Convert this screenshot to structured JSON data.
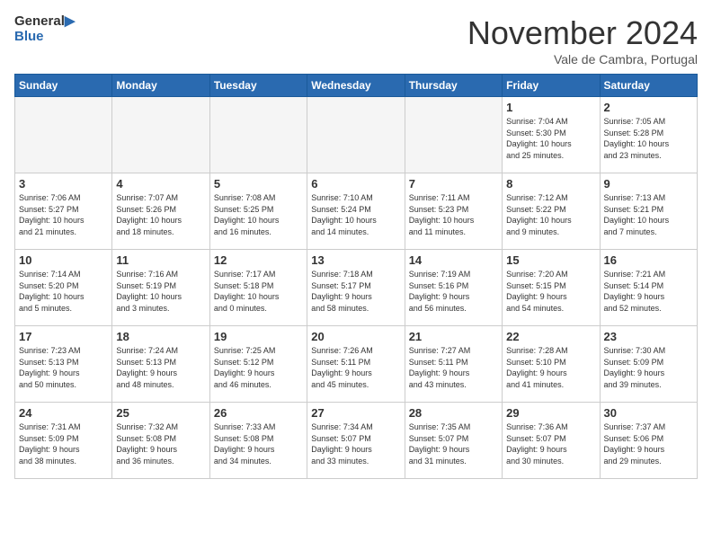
{
  "header": {
    "logo_line1": "General",
    "logo_line2": "Blue",
    "month_title": "November 2024",
    "location": "Vale de Cambra, Portugal"
  },
  "weekdays": [
    "Sunday",
    "Monday",
    "Tuesday",
    "Wednesday",
    "Thursday",
    "Friday",
    "Saturday"
  ],
  "weeks": [
    [
      {
        "day": "",
        "info": ""
      },
      {
        "day": "",
        "info": ""
      },
      {
        "day": "",
        "info": ""
      },
      {
        "day": "",
        "info": ""
      },
      {
        "day": "",
        "info": ""
      },
      {
        "day": "1",
        "info": "Sunrise: 7:04 AM\nSunset: 5:30 PM\nDaylight: 10 hours\nand 25 minutes."
      },
      {
        "day": "2",
        "info": "Sunrise: 7:05 AM\nSunset: 5:28 PM\nDaylight: 10 hours\nand 23 minutes."
      }
    ],
    [
      {
        "day": "3",
        "info": "Sunrise: 7:06 AM\nSunset: 5:27 PM\nDaylight: 10 hours\nand 21 minutes."
      },
      {
        "day": "4",
        "info": "Sunrise: 7:07 AM\nSunset: 5:26 PM\nDaylight: 10 hours\nand 18 minutes."
      },
      {
        "day": "5",
        "info": "Sunrise: 7:08 AM\nSunset: 5:25 PM\nDaylight: 10 hours\nand 16 minutes."
      },
      {
        "day": "6",
        "info": "Sunrise: 7:10 AM\nSunset: 5:24 PM\nDaylight: 10 hours\nand 14 minutes."
      },
      {
        "day": "7",
        "info": "Sunrise: 7:11 AM\nSunset: 5:23 PM\nDaylight: 10 hours\nand 11 minutes."
      },
      {
        "day": "8",
        "info": "Sunrise: 7:12 AM\nSunset: 5:22 PM\nDaylight: 10 hours\nand 9 minutes."
      },
      {
        "day": "9",
        "info": "Sunrise: 7:13 AM\nSunset: 5:21 PM\nDaylight: 10 hours\nand 7 minutes."
      }
    ],
    [
      {
        "day": "10",
        "info": "Sunrise: 7:14 AM\nSunset: 5:20 PM\nDaylight: 10 hours\nand 5 minutes."
      },
      {
        "day": "11",
        "info": "Sunrise: 7:16 AM\nSunset: 5:19 PM\nDaylight: 10 hours\nand 3 minutes."
      },
      {
        "day": "12",
        "info": "Sunrise: 7:17 AM\nSunset: 5:18 PM\nDaylight: 10 hours\nand 0 minutes."
      },
      {
        "day": "13",
        "info": "Sunrise: 7:18 AM\nSunset: 5:17 PM\nDaylight: 9 hours\nand 58 minutes."
      },
      {
        "day": "14",
        "info": "Sunrise: 7:19 AM\nSunset: 5:16 PM\nDaylight: 9 hours\nand 56 minutes."
      },
      {
        "day": "15",
        "info": "Sunrise: 7:20 AM\nSunset: 5:15 PM\nDaylight: 9 hours\nand 54 minutes."
      },
      {
        "day": "16",
        "info": "Sunrise: 7:21 AM\nSunset: 5:14 PM\nDaylight: 9 hours\nand 52 minutes."
      }
    ],
    [
      {
        "day": "17",
        "info": "Sunrise: 7:23 AM\nSunset: 5:13 PM\nDaylight: 9 hours\nand 50 minutes."
      },
      {
        "day": "18",
        "info": "Sunrise: 7:24 AM\nSunset: 5:13 PM\nDaylight: 9 hours\nand 48 minutes."
      },
      {
        "day": "19",
        "info": "Sunrise: 7:25 AM\nSunset: 5:12 PM\nDaylight: 9 hours\nand 46 minutes."
      },
      {
        "day": "20",
        "info": "Sunrise: 7:26 AM\nSunset: 5:11 PM\nDaylight: 9 hours\nand 45 minutes."
      },
      {
        "day": "21",
        "info": "Sunrise: 7:27 AM\nSunset: 5:11 PM\nDaylight: 9 hours\nand 43 minutes."
      },
      {
        "day": "22",
        "info": "Sunrise: 7:28 AM\nSunset: 5:10 PM\nDaylight: 9 hours\nand 41 minutes."
      },
      {
        "day": "23",
        "info": "Sunrise: 7:30 AM\nSunset: 5:09 PM\nDaylight: 9 hours\nand 39 minutes."
      }
    ],
    [
      {
        "day": "24",
        "info": "Sunrise: 7:31 AM\nSunset: 5:09 PM\nDaylight: 9 hours\nand 38 minutes."
      },
      {
        "day": "25",
        "info": "Sunrise: 7:32 AM\nSunset: 5:08 PM\nDaylight: 9 hours\nand 36 minutes."
      },
      {
        "day": "26",
        "info": "Sunrise: 7:33 AM\nSunset: 5:08 PM\nDaylight: 9 hours\nand 34 minutes."
      },
      {
        "day": "27",
        "info": "Sunrise: 7:34 AM\nSunset: 5:07 PM\nDaylight: 9 hours\nand 33 minutes."
      },
      {
        "day": "28",
        "info": "Sunrise: 7:35 AM\nSunset: 5:07 PM\nDaylight: 9 hours\nand 31 minutes."
      },
      {
        "day": "29",
        "info": "Sunrise: 7:36 AM\nSunset: 5:07 PM\nDaylight: 9 hours\nand 30 minutes."
      },
      {
        "day": "30",
        "info": "Sunrise: 7:37 AM\nSunset: 5:06 PM\nDaylight: 9 hours\nand 29 minutes."
      }
    ]
  ]
}
